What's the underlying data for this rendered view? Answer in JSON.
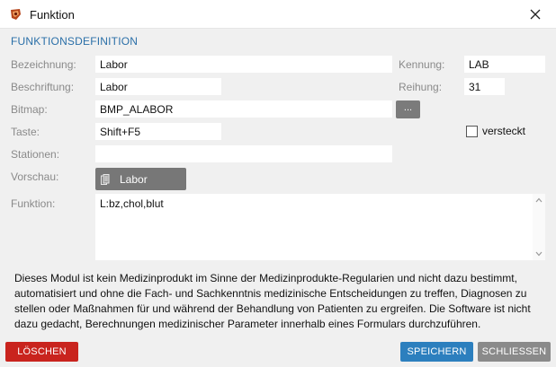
{
  "window": {
    "title": "Funktion",
    "icon": "app-icon",
    "close_icon": "close-icon"
  },
  "section_title": "FUNKTIONSDEFINITION",
  "form": {
    "bezeichnung": {
      "label": "Bezeichnung:",
      "value": "Labor"
    },
    "kennung": {
      "label": "Kennung:",
      "value": "LAB"
    },
    "beschriftung": {
      "label": "Beschriftung:",
      "value": "Labor"
    },
    "reihung": {
      "label": "Reihung:",
      "value": "31"
    },
    "bitmap": {
      "label": "Bitmap:",
      "value": "BMP_ALABOR",
      "browse_label": "..."
    },
    "taste": {
      "label": "Taste:",
      "value": "Shift+F5"
    },
    "versteckt": {
      "label": "versteckt",
      "checked": false
    },
    "stationen": {
      "label": "Stationen:",
      "value": ""
    },
    "vorschau": {
      "label": "Vorschau:",
      "button_label": "Labor",
      "icon": "document-icon"
    },
    "funktion": {
      "label": "Funktion:",
      "value": "L:bz,chol,blut"
    }
  },
  "disclaimer": "Dieses Modul ist kein Medizinprodukt im Sinne der Medizinprodukte-Regularien und nicht dazu bestimmt, automatisiert und ohne die Fach- und Sachkenntnis medizinische Entscheidungen zu treffen, Diagnosen zu stellen oder Maßnahmen für und während der Behandlung von Patienten zu ergreifen. Die Software ist nicht dazu gedacht, Berechnungen medizinischer Parameter innerhalb eines Formulars durchzuführen.",
  "buttons": {
    "delete": "LÖSCHEN",
    "save": "SPEICHERN",
    "close": "SCHLIESSEN"
  },
  "colors": {
    "accent": "#2a6fa8",
    "delete": "#c9241e",
    "save": "#2c7fbe",
    "close": "#8a8a8a"
  }
}
